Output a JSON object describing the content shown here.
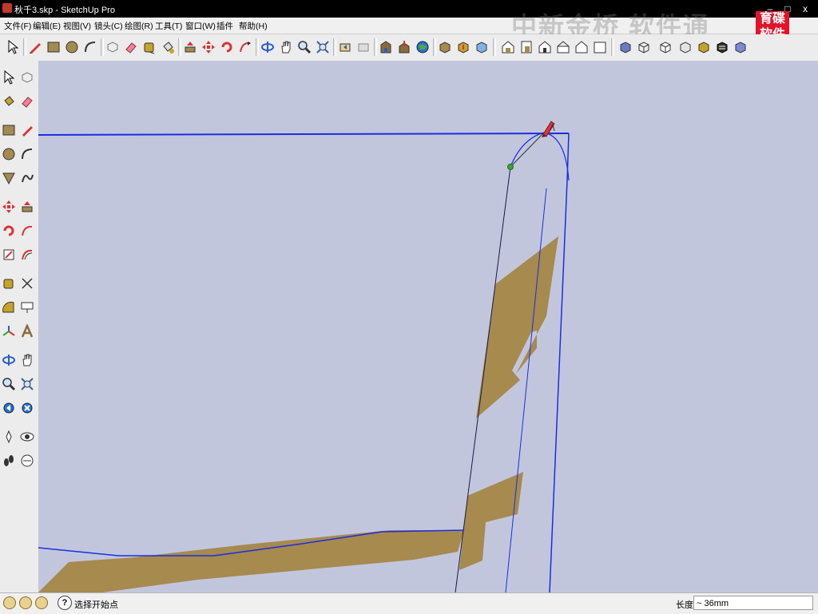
{
  "window": {
    "title": "秋千3.skp - SketchUp Pro",
    "minimize": "–",
    "maximize": "□",
    "close": "x"
  },
  "menu": [
    "文件(F)",
    "编辑(E)",
    "视图(V)",
    "镜头(C)",
    "绘图(R)",
    "工具(T)",
    "窗口(W)",
    "插件",
    "帮助(H)"
  ],
  "watermark": {
    "text": "中新金桥 软件通",
    "logo_text_1": "育碟",
    "logo_text_2": "软件"
  },
  "toolbar_icons": [
    "select-icon",
    "pencil-icon",
    "rectangle-icon",
    "circle-icon",
    "arc-icon",
    "make-component-icon",
    "eraser-icon",
    "tape-measure-icon",
    "paint-bucket-icon",
    "push-pull-icon",
    "move-icon",
    "rotate-icon",
    "follow-me-icon",
    "orbit-icon",
    "pan-icon",
    "zoom-icon",
    "zoom-extents-icon",
    "previous-view-icon",
    "next-view-icon",
    "warehouse-icon",
    "share-model-icon",
    "google-earth-icon",
    "component-get-icon",
    "component-share-icon",
    "extension-icon",
    "iso-view-icon",
    "top-view-icon",
    "front-view-icon",
    "right-view-icon",
    "back-view-icon",
    "left-view-icon",
    "xray-style-icon",
    "wireframe-style-icon",
    "hidden-line-style-icon",
    "shaded-style-icon",
    "shaded-texture-style-icon",
    "monochrome-style-icon"
  ],
  "left_toolbar_icons": [
    "select-icon",
    "make-component-icon",
    "paint-bucket-icon",
    "eraser-icon",
    "rectangle-icon",
    "line-icon",
    "circle-icon",
    "arc-icon",
    "polygon-icon",
    "freehand-icon",
    "move-icon",
    "push-pull-icon",
    "rotate-icon",
    "follow-me-icon",
    "scale-icon",
    "offset-icon",
    "tape-measure-icon",
    "dimension-icon",
    "protractor-icon",
    "text-icon",
    "axes-icon",
    "3d-text-icon",
    "orbit-icon",
    "pan-icon",
    "zoom-icon",
    "zoom-window-icon",
    "previous-icon",
    "zoom-extents-icon",
    "position-camera-icon",
    "look-around-icon",
    "walk-icon",
    "section-plane-icon"
  ],
  "colors": {
    "viewport_bg": "#c2c6dd",
    "edge_blue": "#1a2ee0",
    "edge_dark": "#1a1a40",
    "wood_face": "#a68a4e",
    "endpoint_green": "#3da632"
  },
  "status": {
    "message": "选择开始点",
    "vcb_label": "长度",
    "vcb_value": "~ 36mm"
  }
}
